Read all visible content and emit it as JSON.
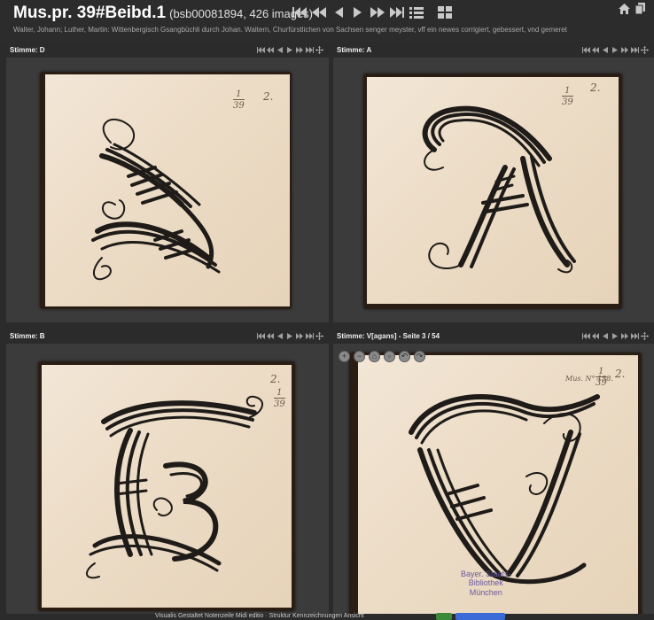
{
  "header": {
    "title": "Mus.pr. 39#Beibd.1",
    "title_sub": "(bsb00081894, 426 images)",
    "subtitle": "Walter, Johann; Luther, Martin: Wittenbergisch Gsangbüchli durch Johan. Waltern, Churfürstlichen von Sachsen senger meyster, vff ein newes corrigiert, gebessert, vnd gemeret",
    "nav_icons": [
      "first-icon",
      "fast-back-icon",
      "prev-icon",
      "next-icon",
      "fast-forward-icon",
      "last-icon",
      "list-icon",
      "grid-icon"
    ],
    "right_icons": [
      "home-icon",
      "pages-icon"
    ]
  },
  "panels": [
    {
      "label": "Stimme: D",
      "folio_top": "1",
      "folio_bottom": "39",
      "folio_extra": "2.",
      "letter": "D"
    },
    {
      "label": "Stimme: A",
      "folio_top": "1",
      "folio_bottom": "39",
      "folio_extra": "2.",
      "letter": "A"
    },
    {
      "label": "Stimme: B",
      "folio_top": "1",
      "folio_bottom": "39",
      "folio_extra": "2.",
      "letter": "B"
    },
    {
      "label": "Stimme: V[agans] - Seite 3 / 54",
      "folio_top": "1",
      "folio_bottom": "39",
      "folio_extra": "2.",
      "letter": "V",
      "shelfmark": "Mus. N° 158.",
      "stamp": [
        "Bayer. Staats-",
        "Bibliothek",
        "München"
      ]
    }
  ],
  "panel_nav_icons": [
    "first-icon",
    "fast-back-icon",
    "prev-icon",
    "next-icon",
    "fast-forward-icon",
    "last-icon",
    "move-icon"
  ],
  "zoom_tools": [
    "zoom-in-icon",
    "zoom-out-icon",
    "home-view-icon",
    "fullscreen-icon",
    "rotate-left-icon",
    "rotate-right-icon"
  ],
  "footer": {
    "text": "Visualis Gestaltet Notenzeile Midi editio · Struktur Kennzeichnungen Ansicht"
  },
  "colors": {
    "background": "#2b2b2b",
    "panel": "#3b3b3b",
    "paper": "#ecdcc6",
    "ink": "#1e1b18",
    "stamp": "#6a5a9e"
  }
}
